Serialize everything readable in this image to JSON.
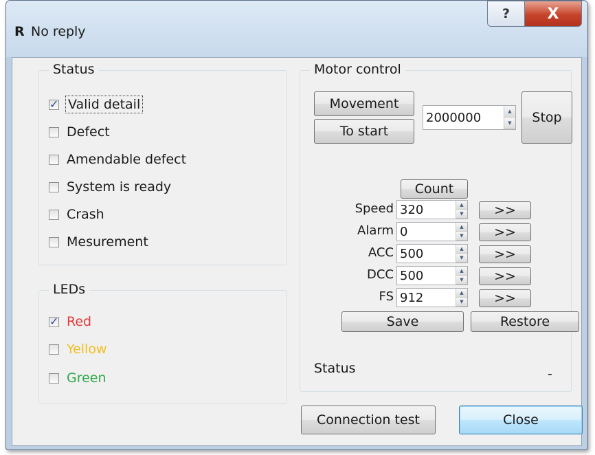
{
  "window": {
    "icon_letter": "R",
    "title": "No reply",
    "help_glyph": "?",
    "close_glyph": "X"
  },
  "status_group": {
    "title": "Status",
    "items": [
      {
        "label": "Valid detail",
        "checked": true
      },
      {
        "label": "Defect",
        "checked": false
      },
      {
        "label": "Amendable defect",
        "checked": false
      },
      {
        "label": "System is ready",
        "checked": false
      },
      {
        "label": "Crash",
        "checked": false
      },
      {
        "label": "Mesurement",
        "checked": false
      }
    ]
  },
  "leds_group": {
    "title": "LEDs",
    "items": [
      {
        "label": "Red",
        "checked": true,
        "color": "#e23b3b"
      },
      {
        "label": "Yellow",
        "checked": false,
        "color": "#f0c020"
      },
      {
        "label": "Green",
        "checked": false,
        "color": "#2fa84a"
      }
    ]
  },
  "motor": {
    "title": "Motor control",
    "movement_label": "Movement",
    "to_start_label": "To start",
    "position_value": "2000000",
    "stop_label": "Stop",
    "count_label": "Count",
    "params": [
      {
        "label": "Speed",
        "value": "320",
        "send": ">>"
      },
      {
        "label": "Alarm",
        "value": "0",
        "send": ">>"
      },
      {
        "label": "ACC",
        "value": "500",
        "send": ">>"
      },
      {
        "label": "DCC",
        "value": "500",
        "send": ">>"
      },
      {
        "label": "FS",
        "value": "912",
        "send": ">>"
      }
    ],
    "save_label": "Save",
    "restore_label": "Restore",
    "status_label": "Status",
    "status_value": "-"
  },
  "footer": {
    "connection_test_label": "Connection test",
    "close_label": "Close"
  }
}
